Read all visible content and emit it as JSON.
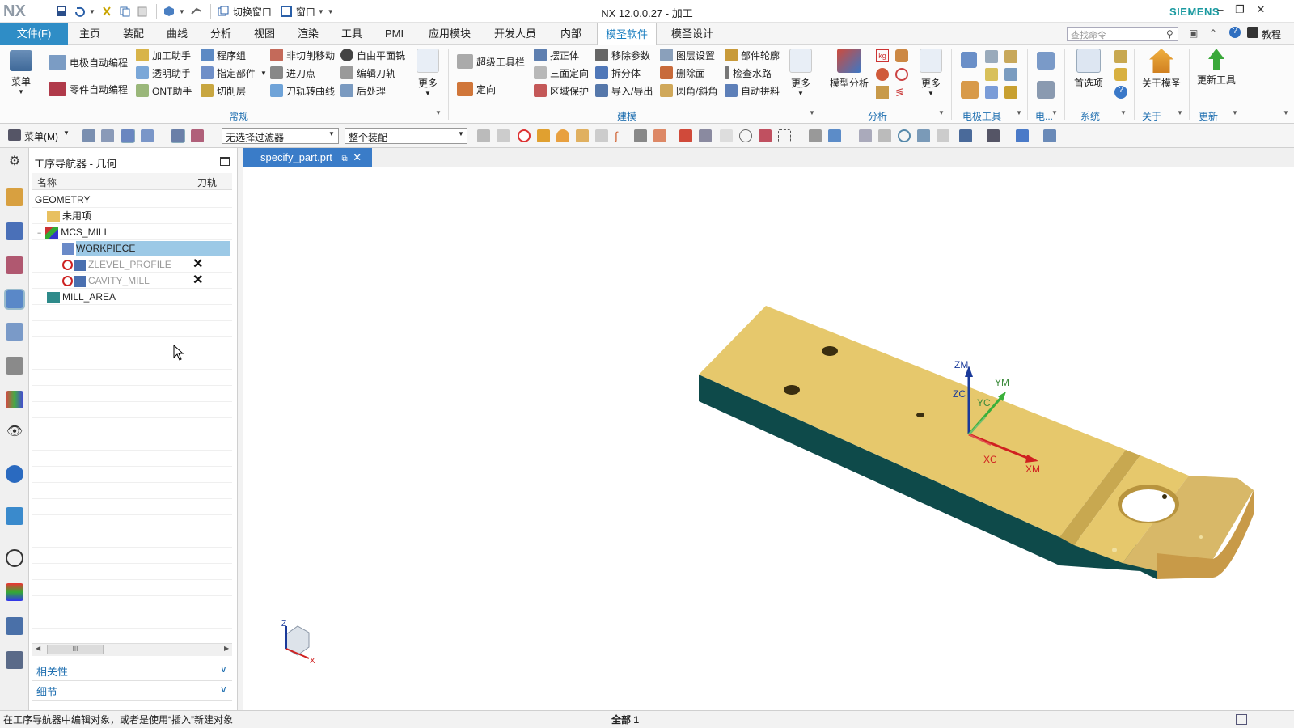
{
  "title_bar": {
    "logo": "NX",
    "title": "NX 12.0.0.27 - 加工",
    "brand": "SIEMENS",
    "switch_window_label": "切换窗口",
    "window_label": "窗口",
    "minimize": "–",
    "restore": "❐",
    "close": "✕"
  },
  "menu_bar": {
    "file_tab": "文件(F)",
    "tabs": [
      "主页",
      "装配",
      "曲线",
      "分析",
      "视图",
      "渲染",
      "工具",
      "PMI",
      "应用模块",
      "开发人员",
      "内部",
      "模圣软件",
      "模圣设计"
    ],
    "active_tab": "模圣软件",
    "search_placeholder": "查找命令",
    "tutorial": "教程"
  },
  "ribbon": {
    "menu_button": "菜单",
    "group_general": {
      "items": [
        "电极自动编程",
        "零件自动编程",
        "加工助手",
        "透明助手",
        "ONT助手",
        "程序组",
        "指定部件",
        "切削层",
        "非切削移动",
        "进刀点",
        "刀轨转曲线",
        "自由平面铣",
        "编辑刀轨",
        "后处理"
      ],
      "more": "更多",
      "label": "常规"
    },
    "group_modeling": {
      "items": [
        "超级工具栏",
        "定向",
        "摆正体",
        "三面定向",
        "区域保护",
        "移除参数",
        "拆分体",
        "导入/导出",
        "图层设置",
        "删除面",
        "圆角/斜角",
        "部件轮廓",
        "检查水路",
        "自动拼料"
      ],
      "more": "更多",
      "label": "建模"
    },
    "group_analysis": {
      "model_analysis": "模型分析",
      "kg": "kg",
      "more": "更多",
      "label": "分析"
    },
    "group_electrode": {
      "label": "电极工具"
    },
    "group_e2": {
      "label": "电..."
    },
    "group_system": {
      "preferences": "首选项",
      "label": "系统"
    },
    "group_about": {
      "about": "关于模圣",
      "label": "关于"
    },
    "group_update": {
      "update_tool": "更新工具",
      "label": "更新"
    }
  },
  "toolbar": {
    "menu_label": "菜单(M)",
    "filter": "无选择过滤器",
    "assembly": "整个装配"
  },
  "navigator": {
    "title": "工序导航器 - 几何",
    "col_name": "名称",
    "col_toolpath": "刀轨",
    "rows": [
      {
        "name": "GEOMETRY",
        "mark": ""
      },
      {
        "name": "未用项",
        "mark": ""
      },
      {
        "name": "MCS_MILL",
        "mark": ""
      },
      {
        "name": "WORKPIECE",
        "mark": ""
      },
      {
        "name": "ZLEVEL_PROFILE",
        "mark": "✕"
      },
      {
        "name": "CAVITY_MILL",
        "mark": "✕"
      },
      {
        "name": "MILL_AREA",
        "mark": ""
      }
    ],
    "panel_dependency": "相关性",
    "panel_details": "细节",
    "scroll_grip": "III"
  },
  "document": {
    "tab_name": "specify_part.prt"
  },
  "axes": {
    "zm": "ZM",
    "ym": "YM",
    "zc": "ZC",
    "yc": "YC",
    "xc": "XC",
    "xm": "XM",
    "triad_z": "Z",
    "triad_x": "X"
  },
  "status": {
    "message": "在工序导航器中编辑对象，或者是使用“插入”新建对象",
    "selection": "全部 1"
  },
  "colors": {
    "accent": "#2f8dc6",
    "part_top": "#e6c86c",
    "part_side": "#0e4a4a",
    "selection": "#9cc9e6"
  }
}
